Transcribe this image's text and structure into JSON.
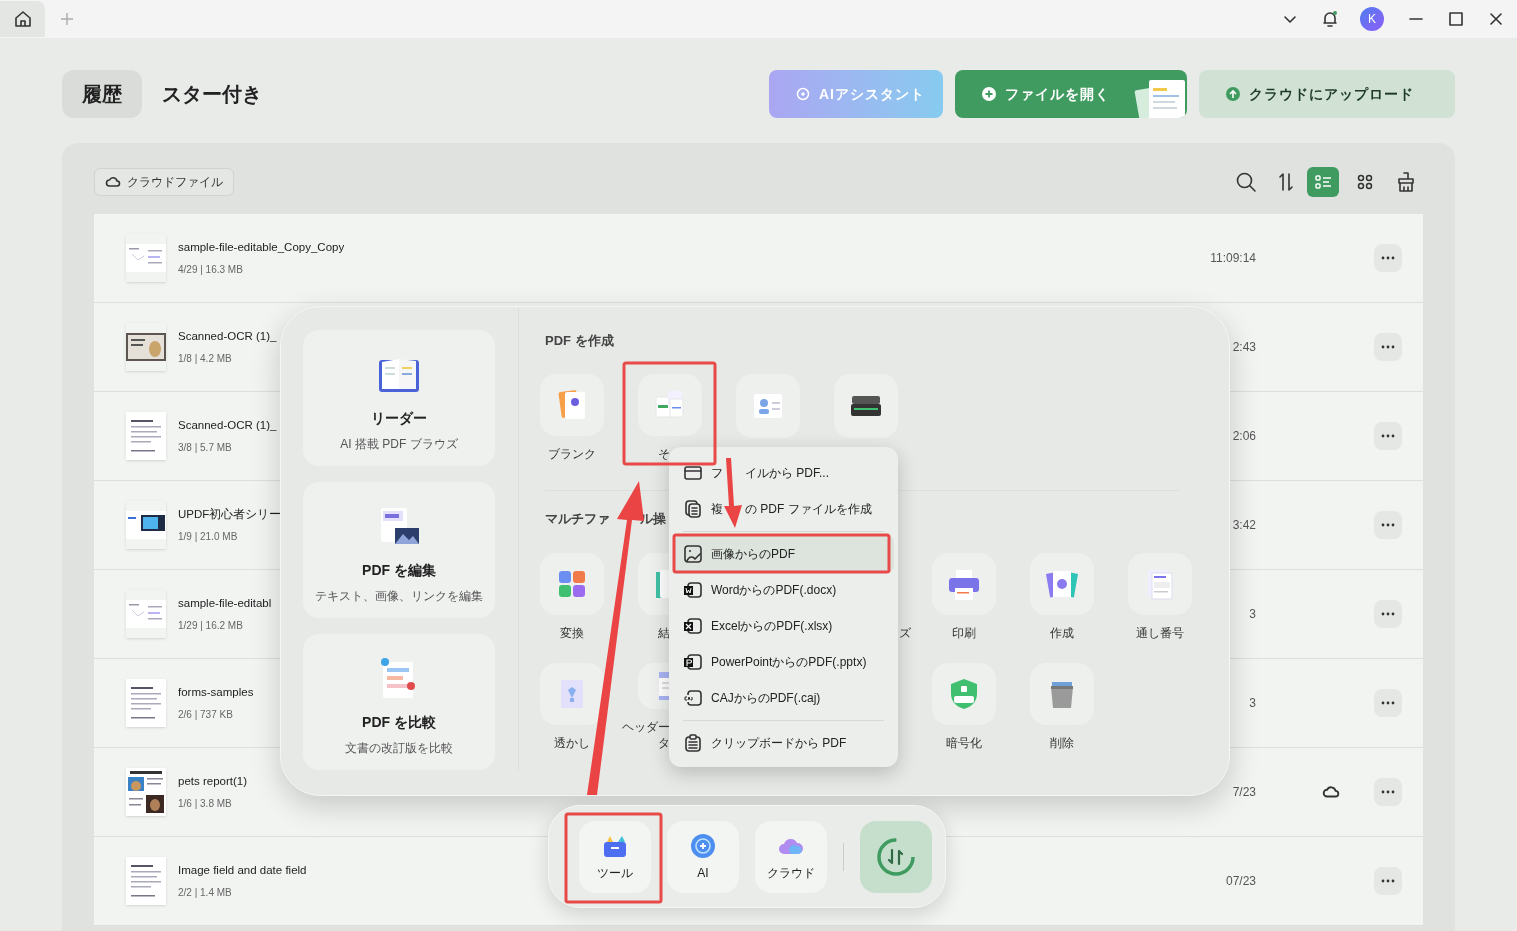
{
  "titlebar": {
    "avatar": "K"
  },
  "header": {
    "tabs": [
      {
        "label": "履歴",
        "selected": true
      },
      {
        "label": "スター付き",
        "selected": false
      }
    ],
    "buttons": [
      {
        "kind": "ai",
        "label": "AIアシスタント"
      },
      {
        "kind": "open",
        "label": "ファイルを開く"
      },
      {
        "kind": "upload",
        "label": "クラウドにアップロード"
      }
    ]
  },
  "toolbar": {
    "cloud_chip": "クラウドファイル",
    "views": [
      {
        "kind": "list",
        "selected": true
      },
      {
        "kind": "grid",
        "selected": false
      }
    ]
  },
  "files": [
    {
      "kind": "form",
      "name": "sample-file-editable_Copy_Copy",
      "meta": "4/29 | 16.3 MB",
      "time": "11:09:14",
      "in_cloud": false
    },
    {
      "kind": "photo",
      "name": "Scanned-OCR (1)_",
      "meta": "1/8 | 4.2 MB",
      "time": "2:43",
      "in_cloud": false
    },
    {
      "kind": "text",
      "name": "Scanned-OCR (1)_",
      "meta": "3/8 | 5.7 MB",
      "time": "2:06",
      "in_cloud": false
    },
    {
      "kind": "slide",
      "name": "UPDF初心者シリー",
      "meta": "1/9 | 21.0 MB",
      "time": "3:42",
      "in_cloud": false
    },
    {
      "kind": "form",
      "name": "sample-file-editabl",
      "meta": "1/29 | 16.2 MB",
      "time": "3",
      "in_cloud": false
    },
    {
      "kind": "text",
      "name": "forms-samples",
      "meta": "2/6 | 737 KB",
      "time": "3",
      "in_cloud": false
    },
    {
      "kind": "report",
      "name": "pets report(1)",
      "meta": "1/6 | 3.8 MB",
      "time": "7/23",
      "in_cloud": true
    },
    {
      "kind": "text",
      "name": "Image field and date field",
      "meta": "2/2 | 1.4 MB",
      "time": "07/23",
      "in_cloud": false
    }
  ],
  "tools_panel": {
    "cards": [
      {
        "kind": "reader",
        "title": "リーダー",
        "subtitle": "AI 搭載 PDF ブラウズ"
      },
      {
        "kind": "edit",
        "title": "PDF を編集",
        "subtitle": "テキスト、画像、リンクを編集"
      },
      {
        "kind": "compare",
        "title": "PDF を比較",
        "subtitle": "文書の改訂版を比較"
      }
    ],
    "create_heading": "PDF を作成",
    "create_items": [
      {
        "kind": "blank",
        "label": "ブランク"
      },
      {
        "kind": "other",
        "label": "そ"
      },
      {
        "kind": "idcard"
      },
      {
        "kind": "scanner"
      }
    ],
    "multi_heading": [
      "マルチファ",
      "ル操"
    ],
    "multi_rows": [
      [
        {
          "kind": "convert",
          "label": "変換"
        },
        {
          "kind": "merge",
          "label": "結"
        },
        {
          "kind": "hidden",
          "label": "ズ"
        },
        {
          "kind": "print",
          "label": "印刷"
        },
        {
          "kind": "create",
          "label": "作成"
        },
        {
          "kind": "bates",
          "label": "通し番号"
        }
      ],
      [
        {
          "kind": "watermark",
          "label": "透かし"
        },
        {
          "kind": "header",
          "label": "ヘッダータ"
        },
        {
          "kind": "encrypt",
          "label": "暗号化"
        },
        {
          "kind": "delete",
          "label": "削除"
        }
      ]
    ]
  },
  "menu": {
    "groups": [
      [
        {
          "kind": "file",
          "label": [
            "フ",
            "イルから PDF..."
          ],
          "selected": false
        },
        {
          "kind": "multi",
          "label": [
            "複",
            "の PDF ファイルを作成"
          ],
          "selected": false
        }
      ],
      [
        {
          "kind": "image",
          "label": "画像からのPDF",
          "selected": true
        },
        {
          "kind": "word",
          "label": "WordからのPDF(.docx)",
          "selected": false
        },
        {
          "kind": "excel",
          "label": "ExcelからのPDF(.xlsx)",
          "selected": false
        },
        {
          "kind": "ppt",
          "label": "PowerPointからのPDF(.pptx)",
          "selected": false
        },
        {
          "kind": "caj",
          "label": "CAJからのPDF(.caj)",
          "selected": false
        }
      ],
      [
        {
          "kind": "clipboard",
          "label": "クリップボードから PDF",
          "selected": false
        }
      ]
    ]
  },
  "dock": {
    "items": [
      {
        "kind": "tools",
        "label": "ツール"
      },
      {
        "kind": "ai",
        "label": "AI"
      },
      {
        "kind": "cloud",
        "label": "クラウド"
      }
    ]
  }
}
